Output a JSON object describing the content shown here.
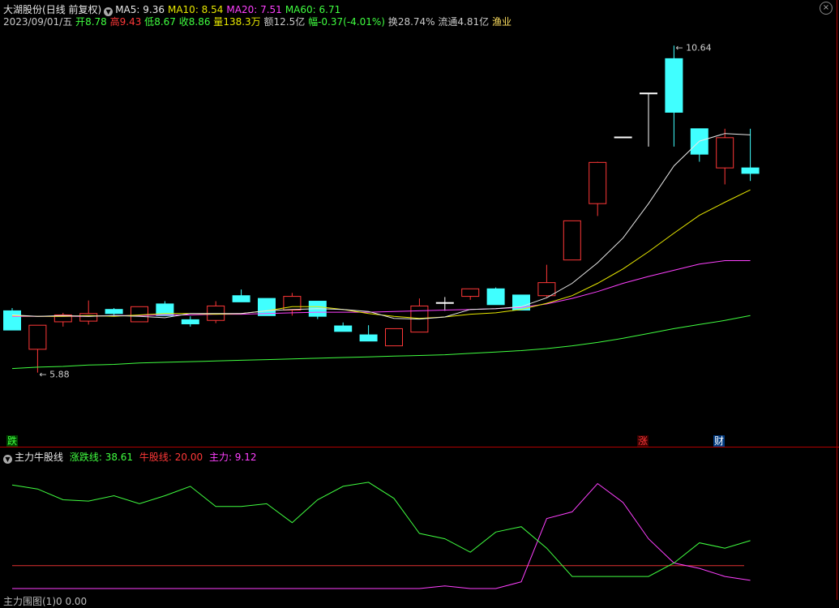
{
  "header": {
    "stock_name": "大湖股份",
    "period_label": "(日线 前复权)",
    "ma": [
      {
        "label": "MA5: 9.36",
        "color": "#e8e8e8"
      },
      {
        "label": "MA10: 8.54",
        "color": "#e8e800"
      },
      {
        "label": "MA20: 7.51",
        "color": "#ff40ff"
      },
      {
        "label": "MA60: 6.71",
        "color": "#40ff40"
      }
    ]
  },
  "quote": {
    "date": "2023/09/01/五",
    "open_label": "开",
    "open": "8.78",
    "high_label": "高",
    "high": "9.43",
    "low_label": "低",
    "low": "8.67",
    "close_label": "收",
    "close": "8.86",
    "vol_label": "量",
    "vol": "138.3万",
    "amount_label": "额",
    "amount": "12.5亿",
    "change_label": "幅",
    "change": "-0.37(-4.01%)",
    "turnover_label": "换",
    "turnover": "28.74%",
    "float_label": "流通",
    "float": "4.81亿",
    "sector": "渔业"
  },
  "annotations": {
    "max_price": "10.64",
    "min_price": "5.88"
  },
  "markers": {
    "left": "跌",
    "zhang": "涨",
    "cai": "财"
  },
  "indicator": {
    "name": "主力牛股线",
    "line1_label": "涨跌线: 38.61",
    "line2_label": "牛股线: 20.00",
    "line3_label": "主力: 9.12"
  },
  "bottom_indicator": {
    "text": "主力围图(1)0 0.00"
  },
  "colors": {
    "up": "#ff3838",
    "down": "#40ffff",
    "ma5": "#e8e8e8",
    "ma10": "#e8e800",
    "ma20": "#ff40ff",
    "ma60": "#40ff40"
  },
  "chart_data": {
    "type": "candlestick",
    "price_range": [
      5.88,
      10.64
    ],
    "candles": [
      {
        "o": 6.78,
        "h": 6.82,
        "l": 6.5,
        "c": 6.5
      },
      {
        "o": 6.22,
        "h": 6.57,
        "l": 5.88,
        "c": 6.57
      },
      {
        "o": 6.62,
        "h": 6.75,
        "l": 6.55,
        "c": 6.72
      },
      {
        "o": 6.63,
        "h": 6.93,
        "l": 6.58,
        "c": 6.74
      },
      {
        "o": 6.8,
        "h": 6.82,
        "l": 6.72,
        "c": 6.74
      },
      {
        "o": 6.62,
        "h": 6.84,
        "l": 6.62,
        "c": 6.84
      },
      {
        "o": 6.88,
        "h": 6.92,
        "l": 6.71,
        "c": 6.71
      },
      {
        "o": 6.65,
        "h": 6.7,
        "l": 6.55,
        "c": 6.59
      },
      {
        "o": 6.64,
        "h": 6.92,
        "l": 6.6,
        "c": 6.85
      },
      {
        "o": 7.0,
        "h": 7.09,
        "l": 6.91,
        "c": 6.91
      },
      {
        "o": 6.96,
        "h": 6.96,
        "l": 6.71,
        "c": 6.71
      },
      {
        "o": 6.79,
        "h": 7.04,
        "l": 6.71,
        "c": 6.99
      },
      {
        "o": 6.92,
        "h": 6.92,
        "l": 6.66,
        "c": 6.7
      },
      {
        "o": 6.56,
        "h": 6.61,
        "l": 6.48,
        "c": 6.48
      },
      {
        "o": 6.43,
        "h": 6.57,
        "l": 6.34,
        "c": 6.34
      },
      {
        "o": 6.27,
        "h": 6.52,
        "l": 6.27,
        "c": 6.52
      },
      {
        "o": 6.47,
        "h": 6.96,
        "l": 6.47,
        "c": 6.85
      },
      {
        "o": 6.9,
        "h": 6.98,
        "l": 6.78,
        "c": 6.9
      },
      {
        "o": 6.99,
        "h": 7.1,
        "l": 6.94,
        "c": 7.1
      },
      {
        "o": 7.1,
        "h": 7.12,
        "l": 6.87,
        "c": 6.87
      },
      {
        "o": 7.01,
        "h": 7.01,
        "l": 6.79,
        "c": 6.79
      },
      {
        "o": 7.0,
        "h": 7.45,
        "l": 6.98,
        "c": 7.19
      },
      {
        "o": 7.52,
        "h": 7.55,
        "l": 7.52,
        "c": 8.09
      },
      {
        "o": 8.34,
        "h": 8.95,
        "l": 8.16,
        "c": 8.94
      },
      {
        "o": 9.31,
        "h": 9.31,
        "l": 9.31,
        "c": 9.31
      },
      {
        "o": 9.95,
        "h": 9.95,
        "l": 9.17,
        "c": 9.95
      },
      {
        "o": 10.45,
        "h": 10.64,
        "l": 9.17,
        "c": 9.67
      },
      {
        "o": 9.43,
        "h": 9.43,
        "l": 8.95,
        "c": 9.06
      },
      {
        "o": 8.86,
        "h": 9.43,
        "l": 8.62,
        "c": 9.3
      },
      {
        "o": 8.86,
        "h": 9.43,
        "l": 8.67,
        "c": 8.78
      }
    ],
    "ma5": [
      6.72,
      6.7,
      6.71,
      6.7,
      6.71,
      6.7,
      6.68,
      6.74,
      6.74,
      6.74,
      6.78,
      6.8,
      6.81,
      6.8,
      6.77,
      6.67,
      6.66,
      6.69,
      6.8,
      6.81,
      6.84,
      6.97,
      7.18,
      7.48,
      7.84,
      8.34,
      8.89,
      9.25,
      9.36,
      9.34
    ],
    "ma10": [
      6.71,
      6.7,
      6.7,
      6.71,
      6.7,
      6.72,
      6.74,
      6.74,
      6.73,
      6.74,
      6.78,
      6.84,
      6.84,
      6.8,
      6.74,
      6.7,
      6.67,
      6.69,
      6.73,
      6.75,
      6.8,
      6.89,
      7.0,
      7.18,
      7.39,
      7.64,
      7.91,
      8.17,
      8.36,
      8.54
    ],
    "ma20": [
      6.7,
      6.7,
      6.7,
      6.7,
      6.71,
      6.71,
      6.72,
      6.72,
      6.73,
      6.73,
      6.74,
      6.75,
      6.76,
      6.76,
      6.76,
      6.77,
      6.78,
      6.79,
      6.8,
      6.81,
      6.83,
      6.88,
      6.96,
      7.06,
      7.18,
      7.28,
      7.37,
      7.46,
      7.51,
      7.51
    ],
    "ma60": [
      5.94,
      5.96,
      5.97,
      5.99,
      6.0,
      6.02,
      6.03,
      6.04,
      6.05,
      6.06,
      6.07,
      6.08,
      6.09,
      6.1,
      6.11,
      6.12,
      6.13,
      6.14,
      6.16,
      6.18,
      6.2,
      6.23,
      6.27,
      6.32,
      6.38,
      6.45,
      6.52,
      6.58,
      6.64,
      6.71
    ],
    "indicator_range": [
      0,
      100
    ],
    "zhangdie": [
      80,
      77,
      69,
      68,
      72,
      66,
      72,
      79,
      64,
      64,
      66,
      52,
      69,
      79,
      82,
      70,
      44,
      40,
      30,
      45,
      49,
      33,
      12,
      12,
      12,
      12,
      22,
      37,
      33,
      38.61
    ],
    "niugu": [
      20,
      20,
      20,
      20,
      20,
      20,
      20,
      20,
      20,
      20,
      20,
      20,
      20,
      20,
      20,
      20,
      20,
      20,
      20,
      20,
      20,
      20,
      20,
      20,
      20,
      20,
      20,
      20,
      20,
      20
    ],
    "zhuli": [
      3,
      3,
      3,
      3,
      3,
      3,
      3,
      3,
      3,
      3,
      3,
      3,
      3,
      3,
      3,
      3,
      3,
      5,
      3,
      3,
      8,
      55,
      60,
      81,
      67,
      40,
      22,
      18,
      12,
      9.12
    ]
  }
}
